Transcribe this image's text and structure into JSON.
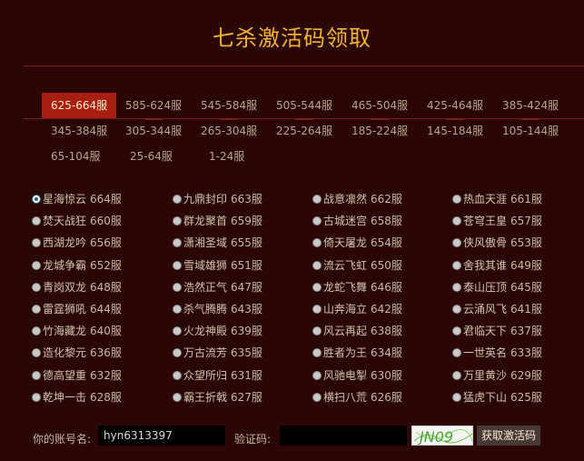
{
  "page": {
    "title": "七杀激活码领取"
  },
  "tabs": [
    {
      "label": "625-664服",
      "active": true
    },
    {
      "label": "585-624服"
    },
    {
      "label": "545-584服"
    },
    {
      "label": "505-544服"
    },
    {
      "label": "465-504服"
    },
    {
      "label": "425-464服"
    },
    {
      "label": "385-424服"
    },
    {
      "label": "345-384服"
    },
    {
      "label": "305-344服"
    },
    {
      "label": "265-304服"
    },
    {
      "label": "225-264服"
    },
    {
      "label": "185-224服"
    },
    {
      "label": "145-184服"
    },
    {
      "label": "105-144服"
    },
    {
      "label": "65-104服"
    },
    {
      "label": "25-64服"
    },
    {
      "label": "1-24服"
    }
  ],
  "servers": [
    {
      "name": "星海惊云",
      "num": "664服",
      "checked": true
    },
    {
      "name": "九鼎封印",
      "num": "663服"
    },
    {
      "name": "战意凛然",
      "num": "662服"
    },
    {
      "name": "热血天涯",
      "num": "661服"
    },
    {
      "name": "焚天战狂",
      "num": "660服"
    },
    {
      "name": "群龙聚首",
      "num": "659服"
    },
    {
      "name": "古城迷宫",
      "num": "658服"
    },
    {
      "name": "苍穹王皇",
      "num": "657服"
    },
    {
      "name": "西湖龙吟",
      "num": "656服"
    },
    {
      "name": "潇湘圣域",
      "num": "655服"
    },
    {
      "name": "倚天屠龙",
      "num": "654服"
    },
    {
      "name": "侠风傲骨",
      "num": "653服"
    },
    {
      "name": "龙城争霸",
      "num": "652服"
    },
    {
      "name": "雪域雄狮",
      "num": "651服"
    },
    {
      "name": "流云飞虹",
      "num": "650服"
    },
    {
      "name": "舍我其谁",
      "num": "649服"
    },
    {
      "name": "青岗双龙",
      "num": "648服"
    },
    {
      "name": "浩然正气",
      "num": "647服"
    },
    {
      "name": "龙蛇飞舞",
      "num": "646服"
    },
    {
      "name": "泰山压顶",
      "num": "645服"
    },
    {
      "name": "雷霆狮吼",
      "num": "644服"
    },
    {
      "name": "杀气腾腾",
      "num": "643服"
    },
    {
      "name": "山奔海立",
      "num": "642服"
    },
    {
      "name": "云涌风飞",
      "num": "641服"
    },
    {
      "name": "竹海藏龙",
      "num": "640服"
    },
    {
      "name": "火龙神殿",
      "num": "639服"
    },
    {
      "name": "风云再起",
      "num": "638服"
    },
    {
      "name": "君临天下",
      "num": "637服"
    },
    {
      "name": "造化黎元",
      "num": "636服"
    },
    {
      "name": "万古流芳",
      "num": "635服"
    },
    {
      "name": "胜者为王",
      "num": "634服"
    },
    {
      "name": "一世英名",
      "num": "633服"
    },
    {
      "name": "德高望重",
      "num": "632服"
    },
    {
      "name": "众望所归",
      "num": "631服"
    },
    {
      "name": "风驰电掣",
      "num": "630服"
    },
    {
      "name": "万里黄沙",
      "num": "629服"
    },
    {
      "name": "乾坤一击",
      "num": "628服"
    },
    {
      "name": "霸王折戟",
      "num": "627服"
    },
    {
      "name": "横扫八荒",
      "num": "626服"
    },
    {
      "name": "猛虎下山",
      "num": "625服"
    }
  ],
  "form": {
    "account_label": "你的账号名:",
    "account_value": "hyn6313397",
    "captcha_label": "验证码:",
    "captcha_value": "",
    "captcha_text": "JN09",
    "submit_label": "获取激活码"
  },
  "colors": {
    "background": "#2a0605",
    "title": "#f2b233",
    "active_tab": "#a81f12",
    "divider": "#7a1d16"
  }
}
